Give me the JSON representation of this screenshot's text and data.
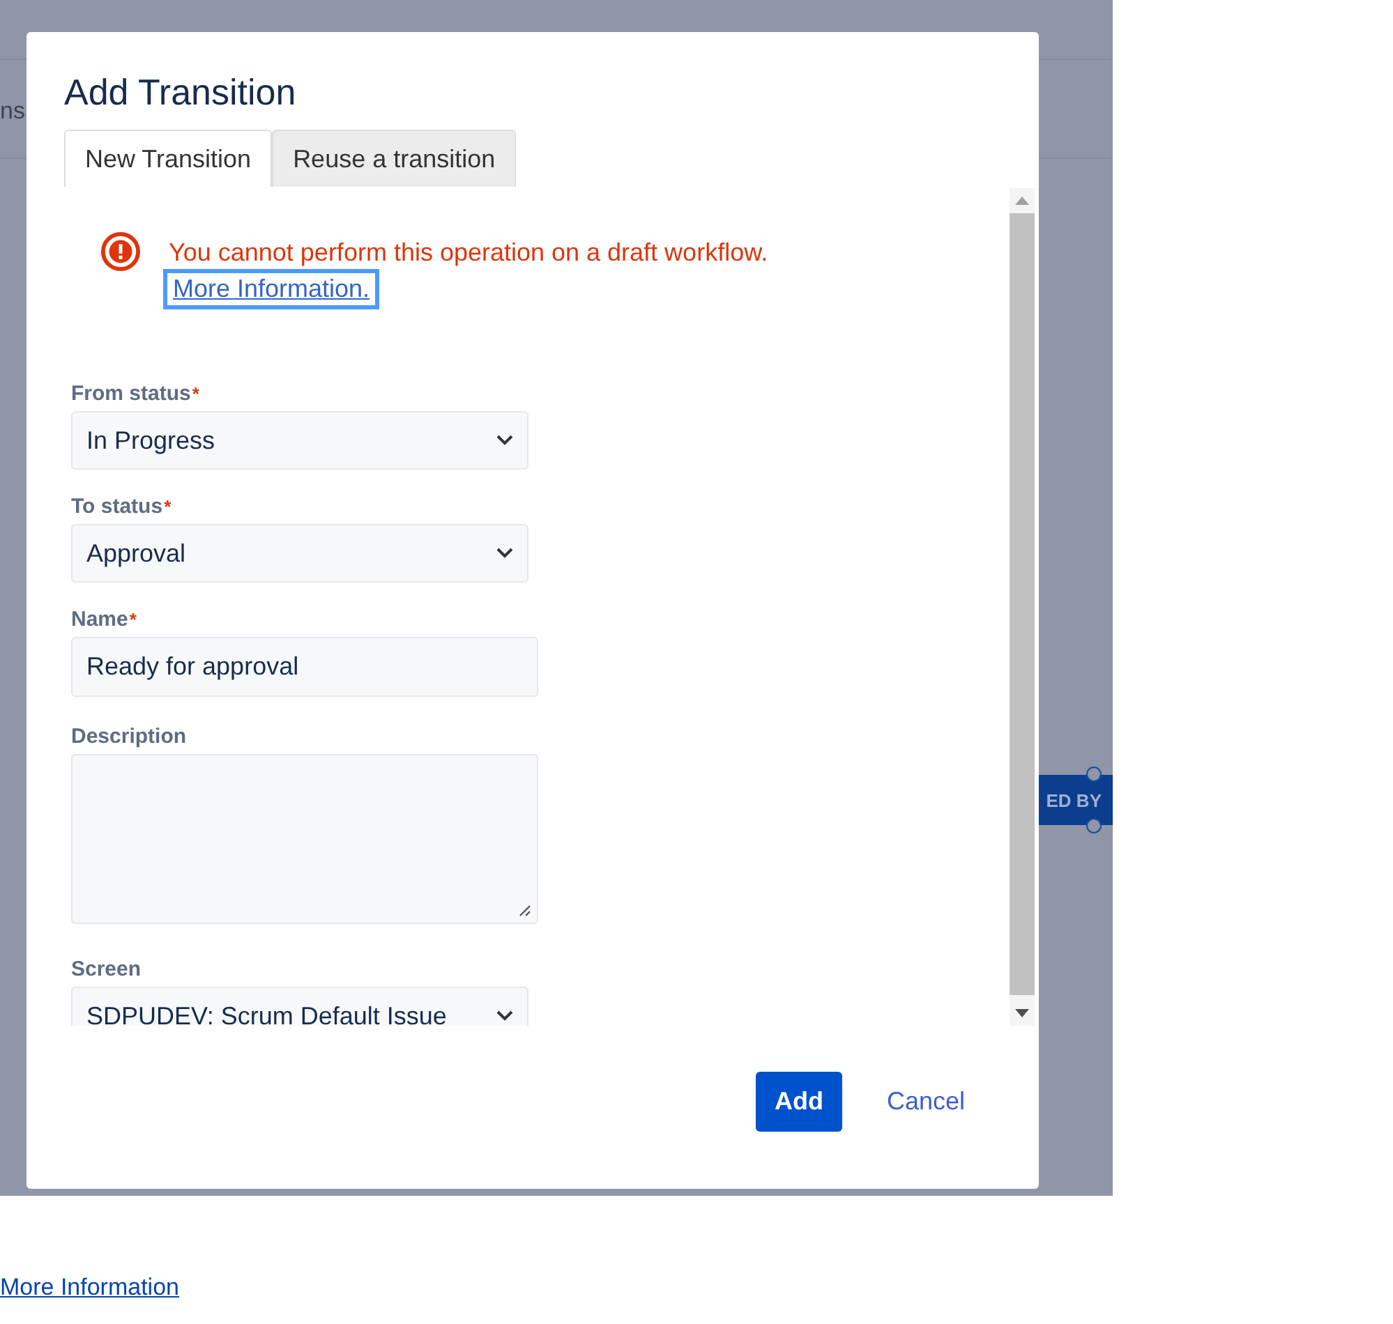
{
  "background": {
    "tab_fragment": "ns",
    "node_label": "ED BY"
  },
  "dialog": {
    "title": "Add Transition",
    "tabs": [
      {
        "label": "New Transition",
        "selected": true
      },
      {
        "label": "Reuse a transition",
        "selected": false
      }
    ],
    "error": {
      "message": "You cannot perform this operation on a draft workflow.",
      "link": "More Information.",
      "link_focused": true
    },
    "fields": [
      {
        "kind": "select",
        "label": "From status",
        "required_mark": "*",
        "value": "In Progress"
      },
      {
        "kind": "select",
        "label": "To status",
        "required_mark": "*",
        "value": "Approval"
      },
      {
        "kind": "text",
        "label": "Name",
        "required_mark": "*",
        "value": "Ready for approval"
      },
      {
        "kind": "textarea",
        "label": "Description"
      },
      {
        "kind": "select",
        "label": "Screen",
        "value": "SDPUDEV: Scrum Default Issue"
      }
    ],
    "buttons": {
      "primary": "Add",
      "cancel": "Cancel"
    }
  },
  "footer_link": "More Information"
}
